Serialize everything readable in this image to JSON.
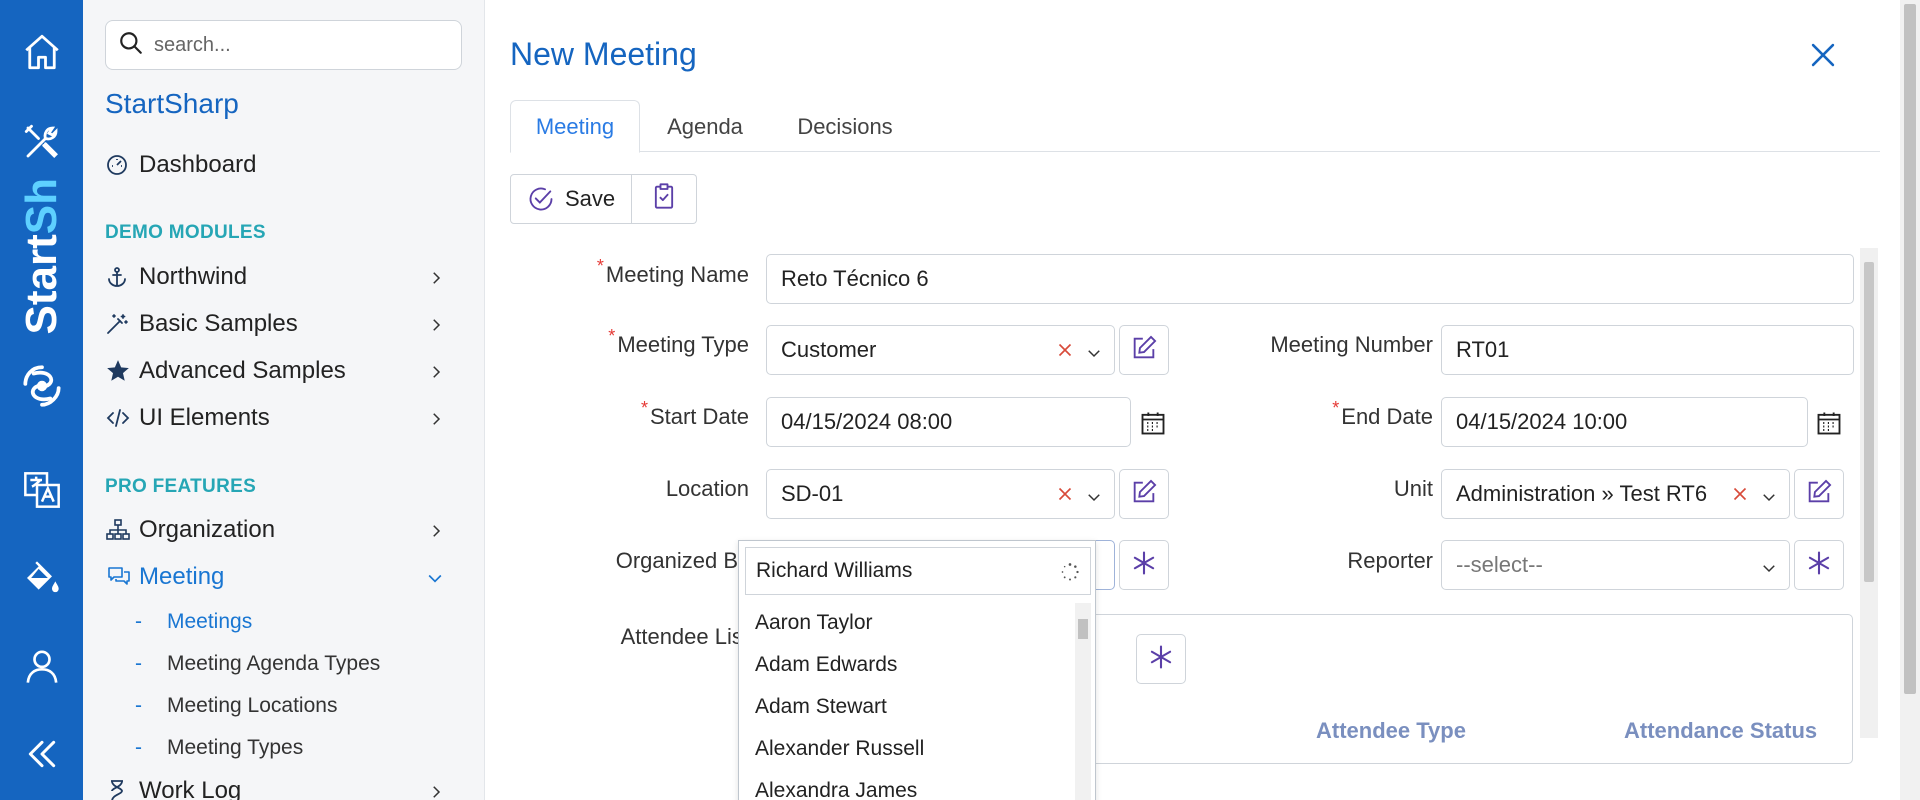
{
  "rail": {
    "brand_text_a": "Start",
    "brand_text_b": "Sh",
    "icons": [
      "home-icon",
      "tools-icon",
      "logo-icon",
      "translate-icon",
      "paint-bucket-icon",
      "user-icon",
      "collapse-icon"
    ]
  },
  "sidebar": {
    "search_placeholder": "search...",
    "app_name": "StartSharp",
    "dashboard": "Dashboard",
    "section_demo": "DEMO MODULES",
    "northwind": "Northwind",
    "basic_samples": "Basic Samples",
    "advanced_samples": "Advanced Samples",
    "ui_elements": "UI Elements",
    "section_pro": "PRO FEATURES",
    "organization": "Organization",
    "meeting": "Meeting",
    "meeting_sub": [
      "Meetings",
      "Meeting Agenda Types",
      "Meeting Locations",
      "Meeting Types"
    ],
    "work_log": "Work Log"
  },
  "dialog": {
    "title": "New Meeting",
    "tabs": [
      "Meeting",
      "Agenda",
      "Decisions"
    ],
    "save_label": "Save"
  },
  "form": {
    "meeting_name_label": "Meeting Name",
    "meeting_name_value": "Reto Técnico 6",
    "meeting_type_label": "Meeting Type",
    "meeting_type_value": "Customer",
    "meeting_number_label": "Meeting Number",
    "meeting_number_value": "RT01",
    "start_date_label": "Start Date",
    "start_date_value": "04/15/2024 08:00",
    "end_date_label": "End Date",
    "end_date_value": "04/15/2024 10:00",
    "location_label": "Location",
    "location_value": "SD-01",
    "unit_label": "Unit",
    "unit_value": "Administration » Test RT6",
    "organized_by_label": "Organized By",
    "reporter_label": "Reporter",
    "reporter_placeholder": "--select--",
    "attendee_list_label": "Attendee List",
    "col_attendee_type": "Attendee Type",
    "col_attendance_status": "Attendance Status",
    "required_mark": "*"
  },
  "popup": {
    "input_value": "Richard Williams",
    "options": [
      "Aaron Taylor",
      "Adam Edwards",
      "Adam Stewart",
      "Alexander Russell",
      "Alexandra James"
    ]
  },
  "colors": {
    "rail": "#1565c0",
    "accent": "#1976d2",
    "section": "#26a6b5",
    "required": "#e53935"
  }
}
